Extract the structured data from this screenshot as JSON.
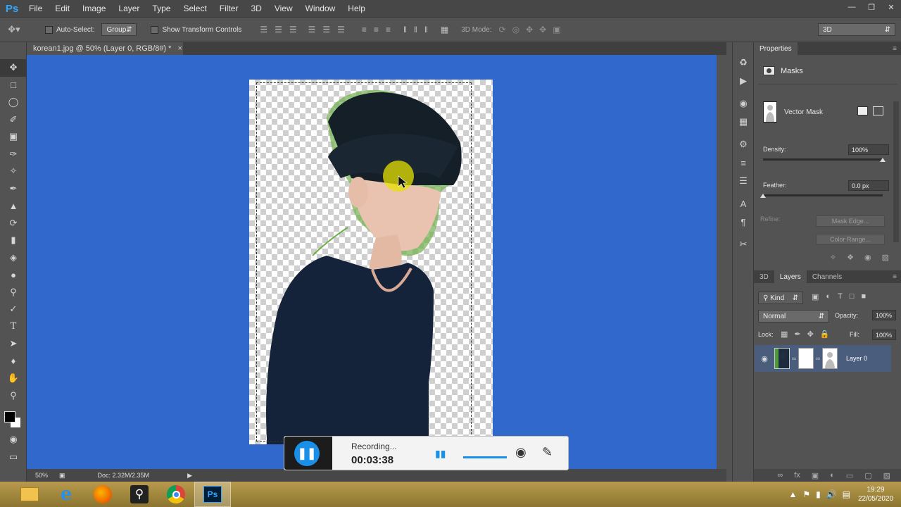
{
  "app": {
    "logo": "Ps"
  },
  "menu": [
    "File",
    "Edit",
    "Image",
    "Layer",
    "Type",
    "Select",
    "Filter",
    "3D",
    "View",
    "Window",
    "Help"
  ],
  "window_controls": [
    "minimize-icon",
    "restore-icon",
    "close-icon"
  ],
  "options": {
    "auto_select_label": "Auto-Select:",
    "auto_select_value": "Group",
    "show_transform_label": "Show Transform Controls",
    "mode_3d_label": "3D Mode:",
    "workspace_value": "3D"
  },
  "document": {
    "tab_title": "korean1.jpg @ 50% (Layer 0, RGB/8#) *",
    "close": "×"
  },
  "status": {
    "zoom": "50%",
    "doc_info": "Doc: 2.32M/2.35M"
  },
  "properties": {
    "title": "Properties",
    "masks_label": "Masks",
    "vector_mask_label": "Vector Mask",
    "density_label": "Density:",
    "density_value": "100%",
    "density_level": 1.0,
    "feather_label": "Feather:",
    "feather_value": "0.0 px",
    "feather_level": 0.0,
    "refine_label": "Refine:",
    "mask_edge_button": "Mask Edge...",
    "color_range_button": "Color Range..."
  },
  "layers_panel": {
    "tabs": [
      "3D",
      "Layers",
      "Channels"
    ],
    "active_tab": "Layers",
    "filter_kind": "Kind",
    "blend_mode": "Normal",
    "opacity_label": "Opacity:",
    "opacity_value": "100%",
    "lock_label": "Lock:",
    "fill_label": "Fill:",
    "fill_value": "100%",
    "layers": [
      {
        "name": "Layer 0",
        "visible": true,
        "selected": true
      }
    ]
  },
  "recorder": {
    "status": "Recording...",
    "time": "00:03:38"
  },
  "taskbar": {
    "apps": [
      "file-explorer-icon",
      "internet-explorer-icon",
      "firefox-icon",
      "search-app-icon",
      "chrome-icon",
      "photoshop-icon"
    ],
    "active_app": "photoshop-icon",
    "time": "19:29",
    "date": "22/05/2020"
  },
  "colors": {
    "canvas_bg": "#3068cc",
    "accent": "#31a8ff",
    "selected_layer": "#4a5d7c"
  }
}
